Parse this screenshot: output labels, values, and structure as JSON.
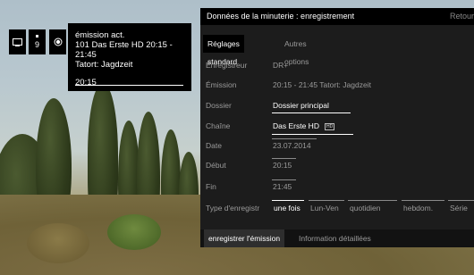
{
  "info_panel": {
    "channel_number": "9",
    "line1": "émission act.",
    "line2": "101 Das Erste HD 20:15 - 21:45",
    "line3": "Tatort: Jagdzeit",
    "time": "20:15",
    "icons": [
      "tv-icon",
      "record-icon"
    ]
  },
  "dialog": {
    "title": "Données de la minuterie : enregistrement",
    "back_label": "Retour",
    "tabs": [
      {
        "label": "Réglages standard",
        "active": true
      },
      {
        "label": "Autres options",
        "active": false
      }
    ],
    "rows": {
      "enregistreur": {
        "label": "Enregistreur",
        "value": "DR+"
      },
      "emission": {
        "label": "Émission",
        "value": "20:15 - 21:45 Tatort: Jagdzeit"
      },
      "dossier": {
        "label": "Dossier",
        "value": "Dossier principal"
      },
      "chaine": {
        "label": "Chaîne",
        "value": "Das Erste HD",
        "badge": "HD"
      },
      "date": {
        "label": "Date",
        "value": "23.07.2014"
      },
      "debut": {
        "label": "Début",
        "value": "20:15"
      },
      "fin": {
        "label": "Fin",
        "value": "21:45"
      },
      "type": {
        "label": "Type d'enregistr"
      }
    },
    "type_options": [
      "une fois",
      "Lun-Ven",
      "quotidien",
      "hebdom.",
      "Série"
    ],
    "type_selected": "une fois",
    "buttons": [
      {
        "label": "enregistrer l'émission",
        "active": true
      },
      {
        "label": "Information détaillées",
        "active": false
      }
    ]
  }
}
